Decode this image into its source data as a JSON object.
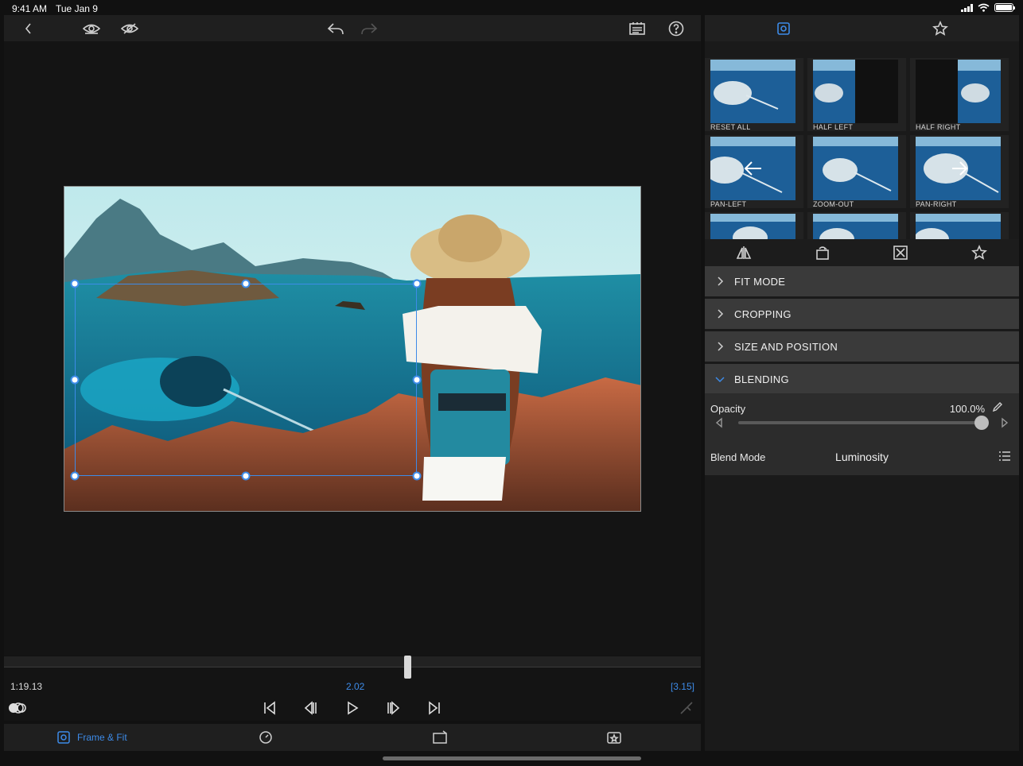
{
  "status_bar": {
    "time": "9:41 AM",
    "date": "Tue Jan 9"
  },
  "colors": {
    "accent": "#3d8be8",
    "panel_bg": "#1a1a1a",
    "section_bg": "#3a3a3a"
  },
  "toolbar": {
    "icons": [
      "back-icon",
      "eye-icon",
      "eye-slash-icon",
      "undo-icon",
      "redo-icon",
      "notes-icon",
      "help-icon"
    ]
  },
  "timeline": {
    "current_time": "1:19.13",
    "clip_time": "2.02",
    "duration": "[3.15]",
    "playhead_fraction": 0.578
  },
  "transport": {
    "icons": [
      "audio-waveform-icon",
      "skip-to-start-icon",
      "step-back-icon",
      "play-icon",
      "step-forward-icon",
      "skip-to-end-icon",
      "razor-icon"
    ]
  },
  "tabbar": {
    "tabs": [
      {
        "label": "Frame & Fit",
        "icon": "frame-fit-icon",
        "active": true
      },
      {
        "label": "",
        "icon": "speed-gauge-icon",
        "active": false
      },
      {
        "label": "",
        "icon": "crop-transform-icon",
        "active": false
      },
      {
        "label": "",
        "icon": "effects-icon",
        "active": false
      }
    ]
  },
  "panel": {
    "tabs": [
      "frame-fit-icon",
      "favorites-star-icon"
    ],
    "presets": [
      {
        "label": "RESET ALL"
      },
      {
        "label": "HALF LEFT"
      },
      {
        "label": "HALF RIGHT"
      },
      {
        "label": "PAN-LEFT"
      },
      {
        "label": "ZOOM-OUT"
      },
      {
        "label": "PAN-RIGHT"
      }
    ],
    "tool_icons": [
      "flip-icon",
      "rotate-icon",
      "fit-icon",
      "star-icon"
    ],
    "sections": [
      {
        "label": "FIT MODE",
        "open": false
      },
      {
        "label": "CROPPING",
        "open": false
      },
      {
        "label": "SIZE AND POSITION",
        "open": false
      },
      {
        "label": "BLENDING",
        "open": true
      }
    ],
    "blending": {
      "opacity_label": "Opacity",
      "opacity_value": "100.0%",
      "opacity_fraction": 1.0,
      "blend_mode_label": "Blend Mode",
      "blend_mode_value": "Luminosity"
    }
  }
}
